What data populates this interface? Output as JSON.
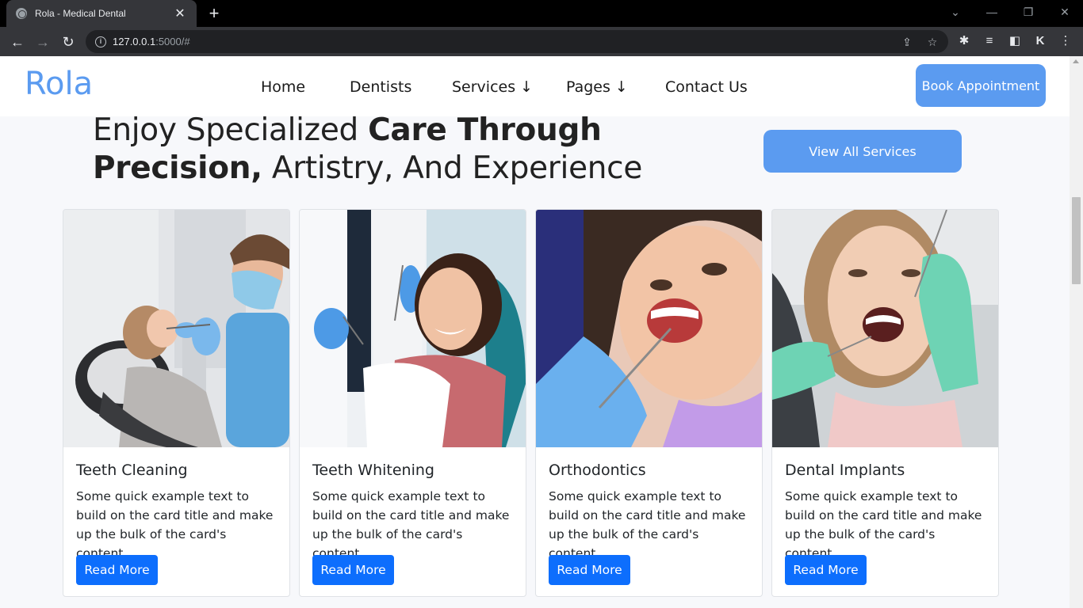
{
  "browser": {
    "tab_title": "Rola - Medical Dental",
    "close_tab": "✕",
    "new_tab": "+",
    "url_host": "127.0.0.1",
    "url_rest": ":5000/#",
    "controls": {
      "chevron": "⌄",
      "minimize": "—",
      "restore": "❐",
      "close": "✕"
    },
    "nav": {
      "back": "←",
      "forward": "→",
      "reload": "↻"
    }
  },
  "site": {
    "brand": "Rola",
    "nav": {
      "home": "Home",
      "dentists": "Dentists",
      "services": "Services ↓",
      "pages": "Pages ↓",
      "contact": "Contact Us"
    },
    "book_button": "Book Appointment"
  },
  "hero": {
    "line1_normal": "Enjoy Specialized ",
    "line1_bold": "Care Through",
    "line2_bold": "Precision,",
    "line2_normal": " Artistry, And Experience",
    "view_all_button": "View All Services"
  },
  "cards": [
    {
      "title": "Teeth Cleaning",
      "text": "Some quick example text to build on the card title and make up the bulk of the card's content.",
      "button": "Read More"
    },
    {
      "title": "Teeth Whitening",
      "text": "Some quick example text to build on the card title and make up the bulk of the card's content.",
      "button": "Read More"
    },
    {
      "title": "Orthodontics",
      "text": "Some quick example text to build on the card title and make up the bulk of the card's content.",
      "button": "Read More"
    },
    {
      "title": "Dental Implants",
      "text": "Some quick example text to build on the card title and make up the bulk of the card's content.",
      "button": "Read More"
    }
  ],
  "colors": {
    "brand_blue": "#5b9bf0",
    "primary_button": "#0d6efd",
    "text_dark": "#212529",
    "page_bg": "#f7f8fb"
  }
}
